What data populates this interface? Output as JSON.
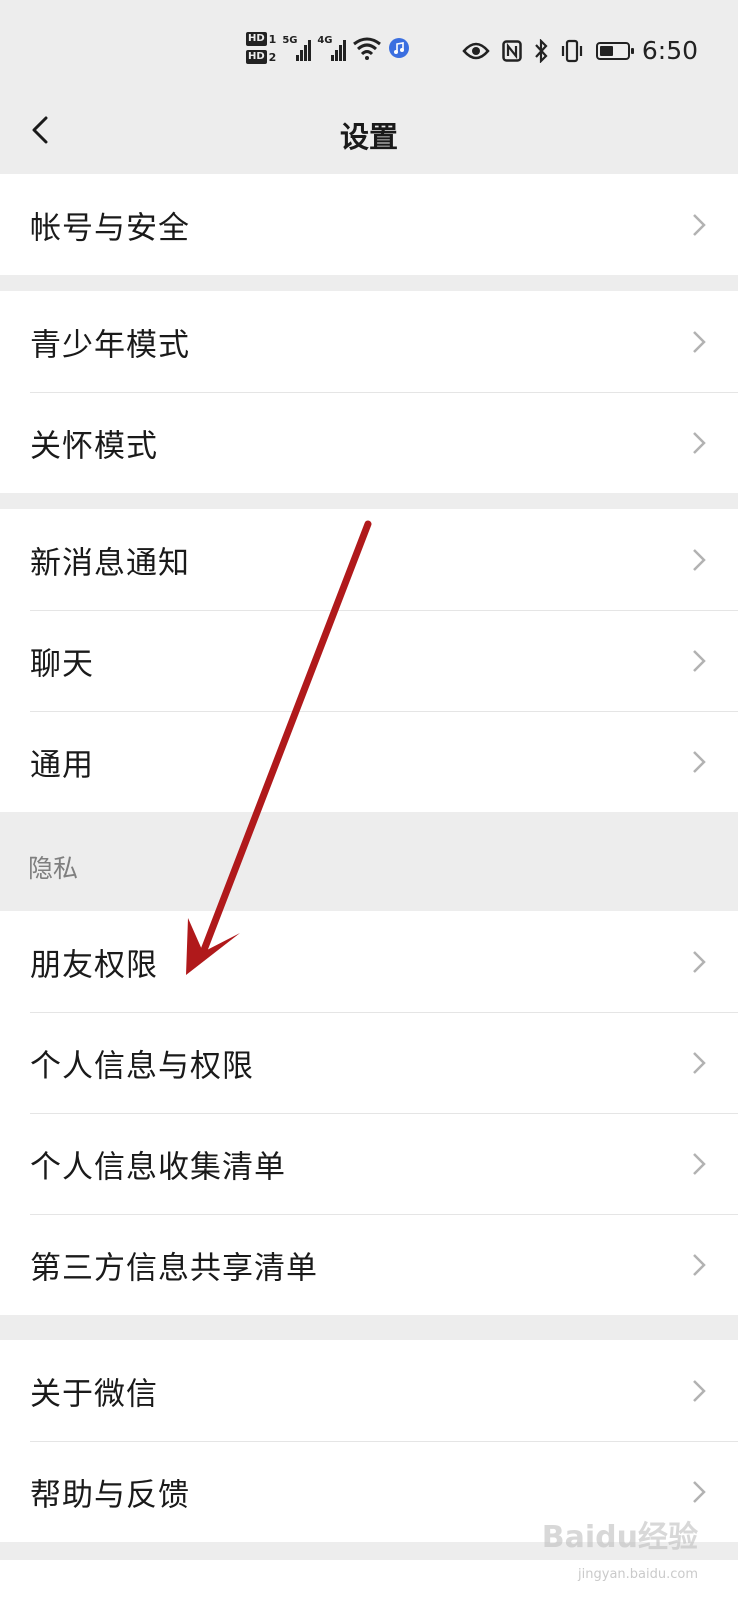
{
  "status_bar": {
    "hd1": "HD",
    "hd1_index": "1",
    "hd2": "HD",
    "hd2_index": "2",
    "network1": "5G",
    "network2": "4G",
    "nfc": "N",
    "time": "6:50",
    "battery_level": 0.55
  },
  "nav": {
    "title": "设置"
  },
  "groups": [
    {
      "items": [
        {
          "label": "帐号与安全"
        }
      ]
    },
    {
      "items": [
        {
          "label": "青少年模式"
        },
        {
          "label": "关怀模式"
        }
      ]
    },
    {
      "items": [
        {
          "label": "新消息通知"
        },
        {
          "label": "聊天"
        },
        {
          "label": "通用"
        }
      ]
    },
    {
      "header": "隐私",
      "items": [
        {
          "label": "朋友权限"
        },
        {
          "label": "个人信息与权限"
        },
        {
          "label": "个人信息收集清单"
        },
        {
          "label": "第三方信息共享清单"
        }
      ]
    },
    {
      "items": [
        {
          "label": "关于微信"
        },
        {
          "label": "帮助与反馈"
        }
      ]
    }
  ],
  "watermark": {
    "text": "Baidu经验",
    "sub": "jingyan.baidu.com"
  },
  "colors": {
    "background": "#ededed",
    "card": "#ffffff",
    "text": "#1a1a1a",
    "secondary_text": "#7f7f7f",
    "annotation_arrow": "#b0191b"
  }
}
